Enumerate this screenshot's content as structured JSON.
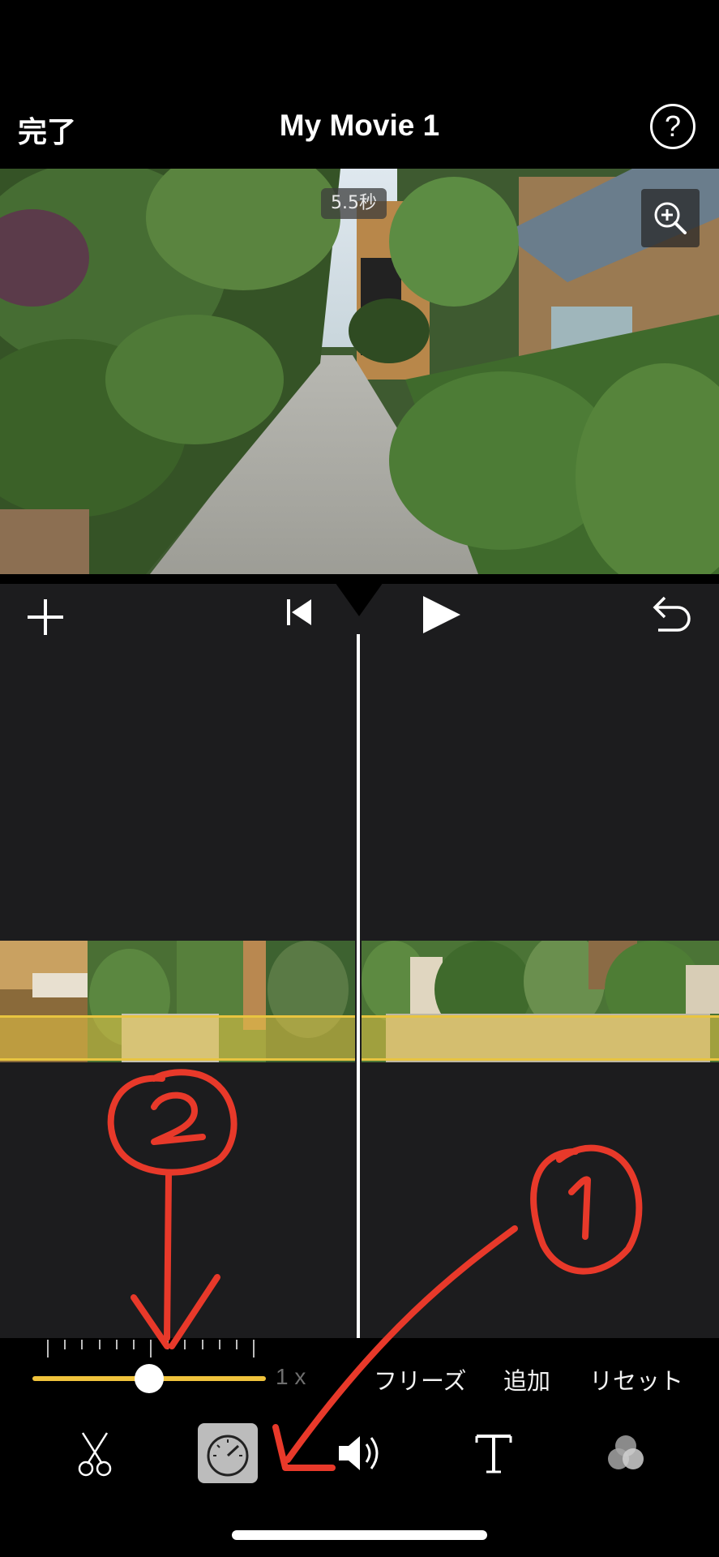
{
  "header": {
    "done_label": "完了",
    "title": "My Movie 1",
    "help_label": "?"
  },
  "preview": {
    "duration": "5.5秒"
  },
  "controls": {
    "add_icon": "plus-icon",
    "skip_back_icon": "skip-to-start-icon",
    "play_icon": "play-icon",
    "undo_icon": "undo-icon"
  },
  "speed": {
    "value_label": "1 x",
    "slider_level": 0.5,
    "freeze_label": "フリーズ",
    "add_label": "追加",
    "reset_label": "リセット"
  },
  "toolbar": {
    "tools": [
      {
        "icon": "scissors-icon",
        "active": false
      },
      {
        "icon": "speedometer-icon",
        "active": true
      },
      {
        "icon": "volume-icon",
        "active": false
      },
      {
        "icon": "text-icon",
        "active": false
      },
      {
        "icon": "filters-icon",
        "active": false
      }
    ]
  },
  "annotations": {
    "color": "#e8392a",
    "items": [
      "1",
      "2"
    ]
  },
  "colors": {
    "accent": "#f0c33c",
    "editor_bg": "#1c1c1e"
  }
}
